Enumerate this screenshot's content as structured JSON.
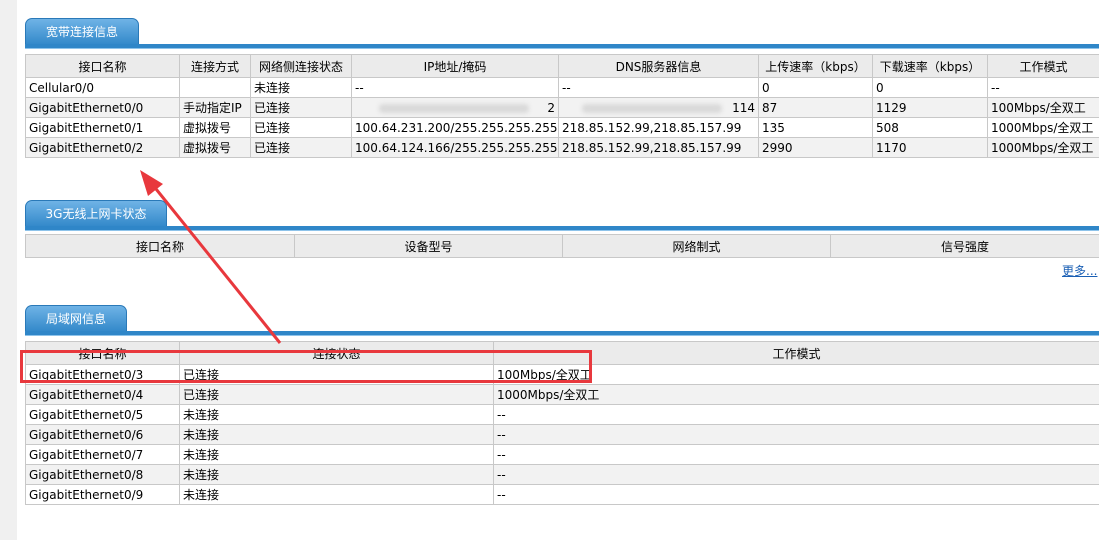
{
  "broadband": {
    "title": "宽带连接信息",
    "headers": [
      "接口名称",
      "连接方式",
      "网络侧连接状态",
      "IP地址/掩码",
      "DNS服务器信息",
      "上传速率（kbps）",
      "下载速率（kbps）",
      "工作模式"
    ],
    "rows": [
      [
        "Cellular0/0",
        "",
        "未连接",
        "--",
        "--",
        "0",
        "0",
        "--"
      ],
      [
        "GigabitEthernet0/0",
        "手动指定IP",
        "已连接",
        "2",
        "114",
        "87",
        "1129",
        "100Mbps/全双工"
      ],
      [
        "GigabitEthernet0/1",
        "虚拟拨号",
        "已连接",
        "100.64.231.200/255.255.255.255",
        "218.85.152.99,218.85.157.99",
        "135",
        "508",
        "1000Mbps/全双工"
      ],
      [
        "GigabitEthernet0/2",
        "虚拟拨号",
        "已连接",
        "100.64.124.166/255.255.255.255",
        "218.85.152.99,218.85.157.99",
        "2990",
        "1170",
        "1000Mbps/全双工"
      ]
    ]
  },
  "wireless": {
    "title": "3G无线上网卡状态",
    "headers": [
      "接口名称",
      "设备型号",
      "网络制式",
      "信号强度"
    ],
    "more_label": "更多..."
  },
  "lan": {
    "title": "局域网信息",
    "headers": [
      "接口名称",
      "连接状态",
      "工作模式"
    ],
    "rows": [
      [
        "GigabitEthernet0/3",
        "已连接",
        "100Mbps/全双工"
      ],
      [
        "GigabitEthernet0/4",
        "已连接",
        "1000Mbps/全双工"
      ],
      [
        "GigabitEthernet0/5",
        "未连接",
        "--"
      ],
      [
        "GigabitEthernet0/6",
        "未连接",
        "--"
      ],
      [
        "GigabitEthernet0/7",
        "未连接",
        "--"
      ],
      [
        "GigabitEthernet0/8",
        "未连接",
        "--"
      ],
      [
        "GigabitEthernet0/9",
        "未连接",
        "--"
      ]
    ]
  },
  "annotation_color": "#e8383d"
}
